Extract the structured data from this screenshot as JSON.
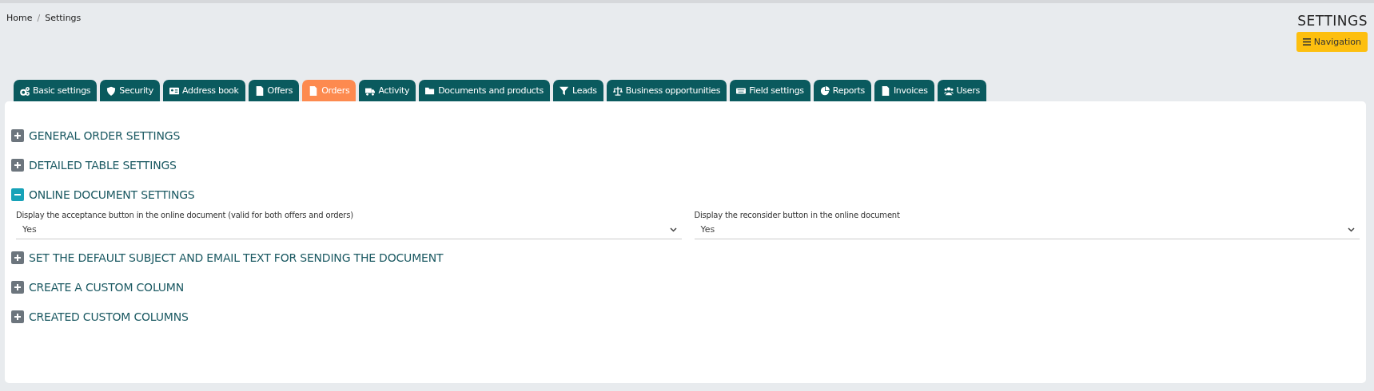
{
  "breadcrumb": [
    {
      "label": "Home"
    },
    {
      "label": "Settings"
    }
  ],
  "breadcrumb_separator": "/",
  "page_title": "SETTINGS",
  "navigation_button": "Navigation",
  "tabs": [
    {
      "label": "Basic settings",
      "selected": false
    },
    {
      "label": "Security",
      "selected": false
    },
    {
      "label": "Address book",
      "selected": false
    },
    {
      "label": "Offers",
      "selected": false
    },
    {
      "label": "Orders",
      "selected": true
    },
    {
      "label": "Activity",
      "selected": false
    },
    {
      "label": "Documents and products",
      "selected": false
    },
    {
      "label": "Leads",
      "selected": false
    },
    {
      "label": "Business opportunities",
      "selected": false
    },
    {
      "label": "Field settings",
      "selected": false
    },
    {
      "label": "Reports",
      "selected": false
    },
    {
      "label": "Invoices",
      "selected": false
    },
    {
      "label": "Users",
      "selected": false
    }
  ],
  "sections": [
    {
      "title": "GENERAL ORDER SETTINGS",
      "expanded": false
    },
    {
      "title": "DETAILED TABLE SETTINGS",
      "expanded": false
    },
    {
      "title": "ONLINE DOCUMENT SETTINGS",
      "expanded": true,
      "fields": [
        {
          "label": "Display the acceptance button in the online document (valid for both offers and orders)",
          "value": "Yes"
        },
        {
          "label": "Display the reconsider button in the online document",
          "value": "Yes"
        }
      ]
    },
    {
      "title": "SET THE DEFAULT SUBJECT AND EMAIL TEXT FOR SENDING THE DOCUMENT",
      "expanded": false
    },
    {
      "title": "CREATE A CUSTOM COLUMN",
      "expanded": false
    },
    {
      "title": "CREATED CUSTOM COLUMNS",
      "expanded": false
    }
  ]
}
